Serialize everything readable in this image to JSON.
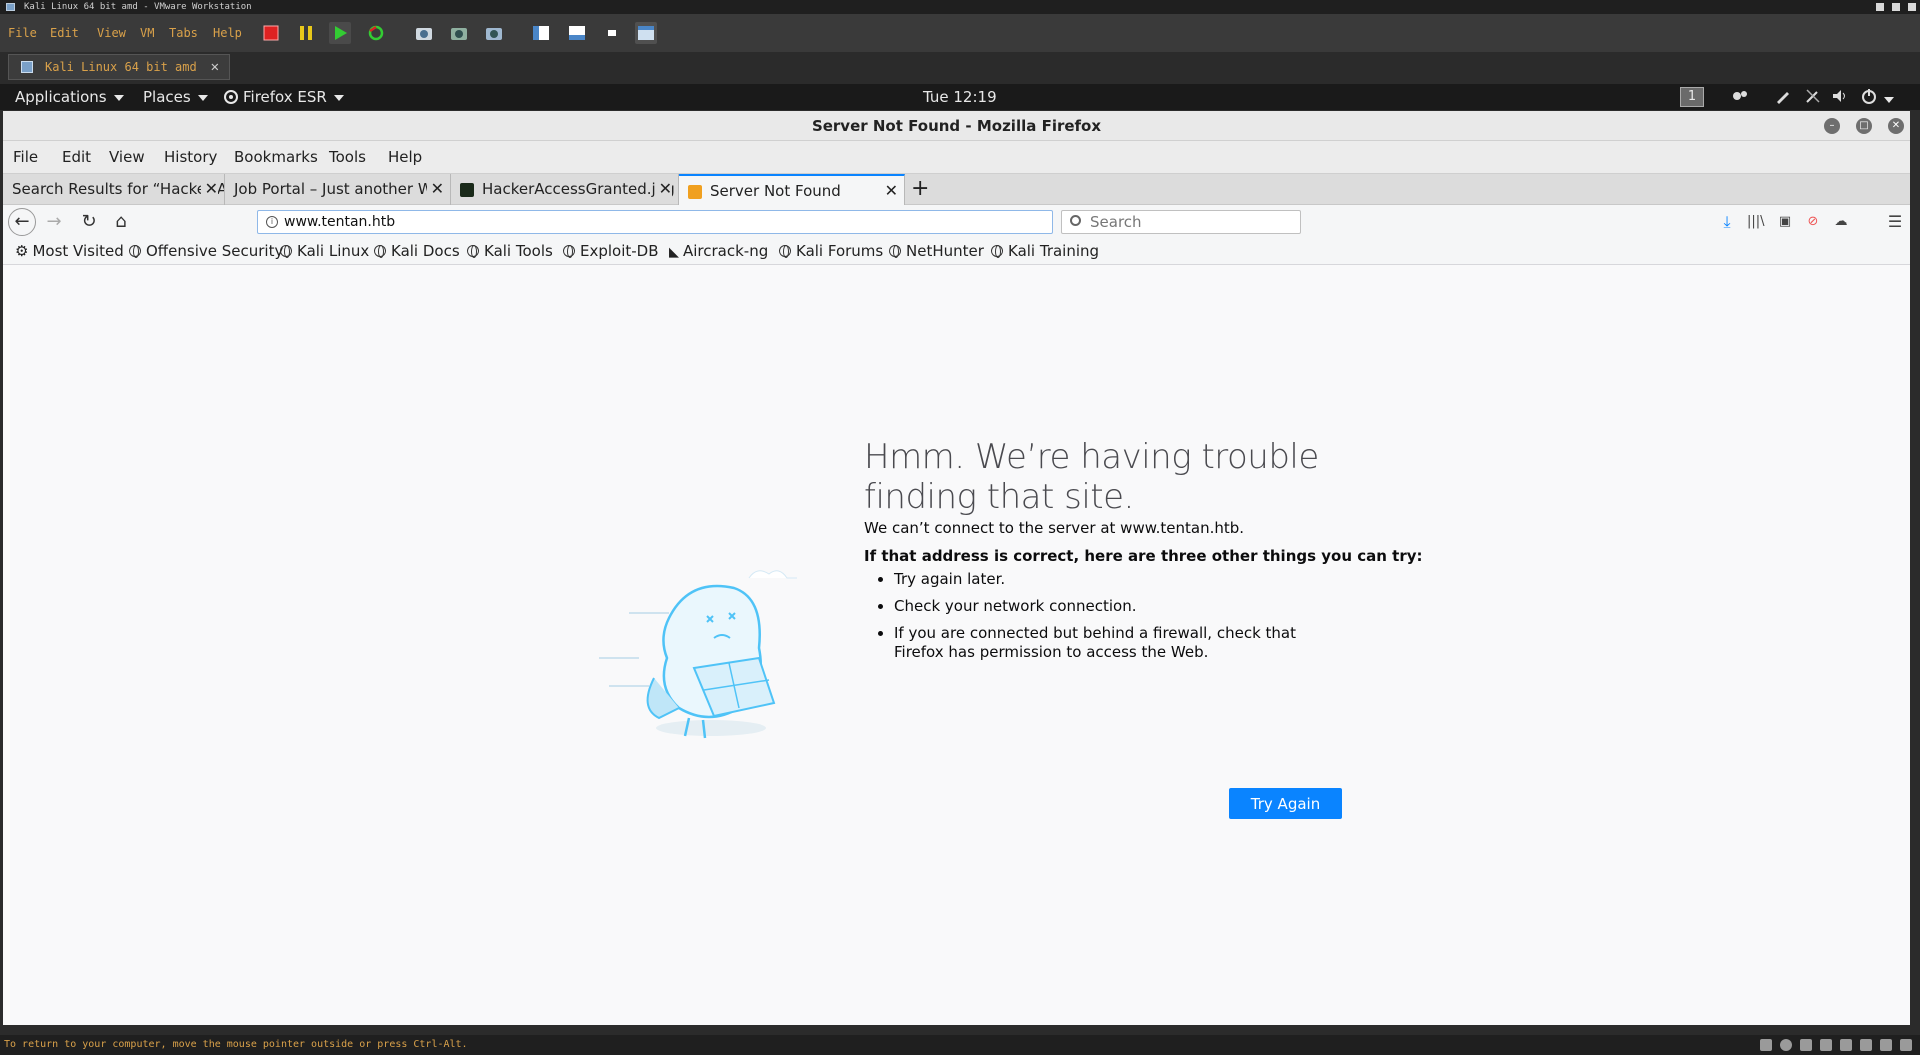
{
  "vmware": {
    "window_title": "Kali Linux 64 bit amd - VMware Workstation",
    "menu": [
      "File",
      "Edit",
      "View",
      "VM",
      "Tabs",
      "Help"
    ],
    "tab_label": "Kali Linux 64 bit amd",
    "status_text": "To return to your computer, move the mouse pointer outside or press Ctrl-Alt."
  },
  "gnome_panel": {
    "applications": "Applications",
    "places": "Places",
    "firefox": "Firefox ESR",
    "clock": "Tue 12:19",
    "workspace": "1"
  },
  "firefox": {
    "window_title": "Server Not Found - Mozilla Firefox",
    "menu": [
      "File",
      "Edit",
      "View",
      "History",
      "Bookmarks",
      "Tools",
      "Help"
    ],
    "tabs": [
      {
        "label": "Search Results for “Hacker A",
        "active": false
      },
      {
        "label": "Job Portal – Just another Wo",
        "active": false
      },
      {
        "label": "HackerAccessGranted.jpg",
        "active": false
      },
      {
        "label": "Server Not Found",
        "active": true
      }
    ],
    "url": "www.tentan.htb",
    "search_placeholder": "Search",
    "bookmarks": [
      "Most Visited",
      "Offensive Security",
      "Kali Linux",
      "Kali Docs",
      "Kali Tools",
      "Exploit-DB",
      "Aircrack-ng",
      "Kali Forums",
      "NetHunter",
      "Kali Training"
    ]
  },
  "error_page": {
    "title": "Hmm. We’re having trouble finding that site.",
    "description": "We can’t connect to the server at www.tentan.htb.",
    "suggest_heading": "If that address is correct, here are three other things you can try:",
    "suggestions": [
      "Try again later.",
      "Check your network connection.",
      "If you are connected but behind a firewall, check that Firefox has permission to access the Web."
    ],
    "button": "Try Again"
  },
  "colors": {
    "accent": "#0a84ff",
    "vmware_menu_text": "#d9a14a",
    "illustration": "#4fc3f7"
  }
}
